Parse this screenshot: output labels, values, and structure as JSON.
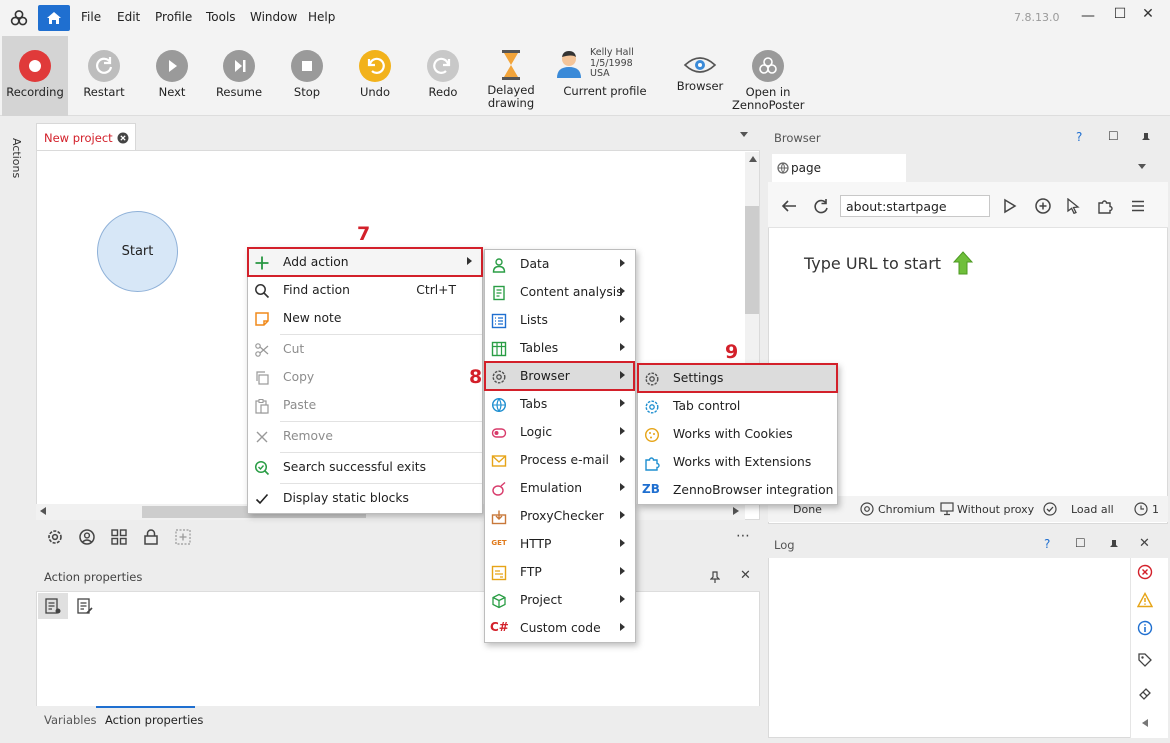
{
  "app": {
    "menu": [
      "File",
      "Edit",
      "Profile",
      "Tools",
      "Window",
      "Help"
    ],
    "version": "7.8.13.0",
    "window_controls": {
      "minimize": "—",
      "maximize": "☐",
      "close": "✕"
    }
  },
  "toolbar": {
    "recording": "Recording",
    "restart": "Restart",
    "next": "Next",
    "resume": "Resume",
    "stop": "Stop",
    "undo": "Undo",
    "redo": "Redo",
    "delayed_drawing": [
      "Delayed",
      "drawing"
    ],
    "profile": {
      "name": "Kelly Hall",
      "dob": "1/5/1998",
      "country": "USA",
      "label": "Current profile"
    },
    "browser": "Browser",
    "open_in": [
      "Open in",
      "ZennoPoster"
    ],
    "colors": {
      "recording": "#e03a3a",
      "undo": "#f2b21b",
      "accent": "#1f6fd0"
    }
  },
  "sidebar": {
    "actions": "Actions"
  },
  "editor": {
    "tab_title": "New project",
    "start_node": "Start"
  },
  "context_menu": {
    "items": [
      {
        "label": "Add action",
        "icon": "plus-icon",
        "submenu": true
      },
      {
        "label": "Find action",
        "icon": "search-icon",
        "shortcut": "Ctrl+T"
      },
      {
        "label": "New note",
        "icon": "note-icon"
      },
      {
        "label": "Cut",
        "icon": "scissors-icon",
        "disabled": true
      },
      {
        "label": "Copy",
        "icon": "copy-icon",
        "disabled": true
      },
      {
        "label": "Paste",
        "icon": "paste-icon",
        "disabled": true
      },
      {
        "label": "Remove",
        "icon": "x-icon",
        "disabled": true
      },
      {
        "label": "Search successful exits",
        "icon": "check-search-icon"
      },
      {
        "label": "Display static blocks",
        "icon": "checkmark-icon"
      }
    ]
  },
  "submenu_actions": {
    "items": [
      "Data",
      "Content analysis",
      "Lists",
      "Tables",
      "Browser",
      "Tabs",
      "Logic",
      "Process e-mail",
      "Emulation",
      "ProxyChecker",
      "HTTP",
      "FTP",
      "Project",
      "Custom code"
    ],
    "http_badge": "GET",
    "csharp_badge": "C#"
  },
  "submenu_browser": {
    "items": [
      "Settings",
      "Tab control",
      "Works with Cookies",
      "Works with Extensions",
      "ZennoBrowser integration"
    ],
    "zb_badge": "ZB"
  },
  "steps": {
    "seven": "7",
    "eight": "8",
    "nine": "9"
  },
  "props": {
    "title": "Action properties",
    "tabs": [
      "Variables",
      "Action properties"
    ]
  },
  "browser_panel": {
    "title": "Browser",
    "help": "?",
    "tab": "page",
    "url": "about:startpage",
    "placeholder_msg": "Type URL to start",
    "status": [
      "Done",
      "Chromium",
      "Without proxy",
      "Load all"
    ],
    "status_last": "1"
  },
  "log_panel": {
    "title": "Log",
    "help": "?"
  }
}
